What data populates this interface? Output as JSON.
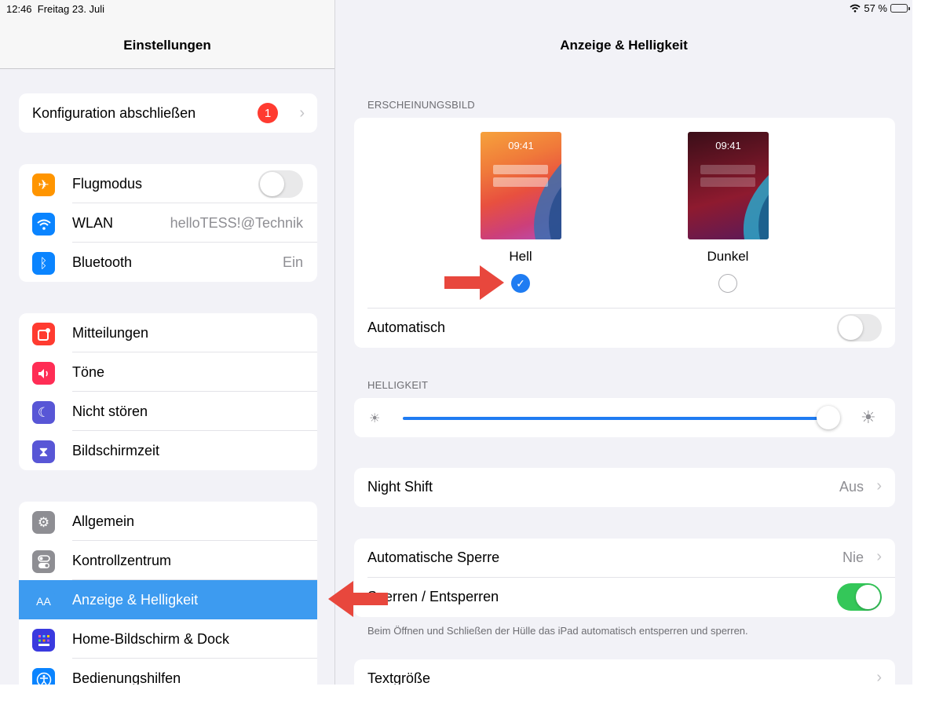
{
  "status": {
    "time": "12:46",
    "date": "Freitag 23. Juli",
    "battery": "57 %",
    "battery_level": 0.57
  },
  "sidebar": {
    "title": "Einstellungen",
    "config": {
      "label": "Konfiguration abschließen",
      "badge": "1"
    },
    "connectivity": [
      {
        "label": "Flugmodus",
        "icon": "airplane-icon",
        "color": "#ff9500",
        "toggle": false
      },
      {
        "label": "WLAN",
        "icon": "wifi-icon",
        "color": "#0a84ff",
        "value": "helloTESS!@Technik"
      },
      {
        "label": "Bluetooth",
        "icon": "bluetooth-icon",
        "color": "#0a84ff",
        "value": "Ein"
      }
    ],
    "notifications": [
      {
        "label": "Mitteilungen",
        "icon": "notifications-icon",
        "color": "#ff3b30"
      },
      {
        "label": "Töne",
        "icon": "speaker-icon",
        "color": "#ff2d55"
      },
      {
        "label": "Nicht stören",
        "icon": "moon-icon",
        "color": "#5856d6"
      },
      {
        "label": "Bildschirmzeit",
        "icon": "hourglass-icon",
        "color": "#5856d6"
      }
    ],
    "general": [
      {
        "label": "Allgemein",
        "icon": "gear-icon",
        "color": "#8e8e93"
      },
      {
        "label": "Kontrollzentrum",
        "icon": "switches-icon",
        "color": "#8e8e93"
      },
      {
        "label": "Anzeige & Helligkeit",
        "icon": "text-size-icon",
        "icon_text": "AA",
        "color": "#0a84ff",
        "selected": true
      },
      {
        "label": "Home-Bildschirm & Dock",
        "icon": "home-grid-icon",
        "color": "#3a3adf"
      },
      {
        "label": "Bedienungshilfen",
        "icon": "accessibility-icon",
        "color": "#0a84ff"
      }
    ]
  },
  "detail": {
    "title": "Anzeige & Helligkeit",
    "appearance_header": "ERSCHEINUNGSBILD",
    "light": {
      "time": "09:41",
      "label": "Hell",
      "selected": true
    },
    "dark": {
      "time": "09:41",
      "label": "Dunkel",
      "selected": false
    },
    "automatic": {
      "label": "Automatisch",
      "on": false
    },
    "brightness_header": "HELLIGKEIT",
    "brightness_level": 0.98,
    "night_shift": {
      "label": "Night Shift",
      "value": "Aus"
    },
    "auto_lock": {
      "label": "Automatische Sperre",
      "value": "Nie"
    },
    "lock_unlock": {
      "label": "Sperren / Entsperren",
      "on": true
    },
    "lock_footnote": "Beim Öffnen und Schließen der Hülle das iPad automatisch entsperren und sperren.",
    "text_size": {
      "label": "Textgröße"
    }
  },
  "colors": {
    "accent": "#1f7cf2",
    "annotation_arrow": "#e8473d",
    "switch_on": "#34c759"
  }
}
